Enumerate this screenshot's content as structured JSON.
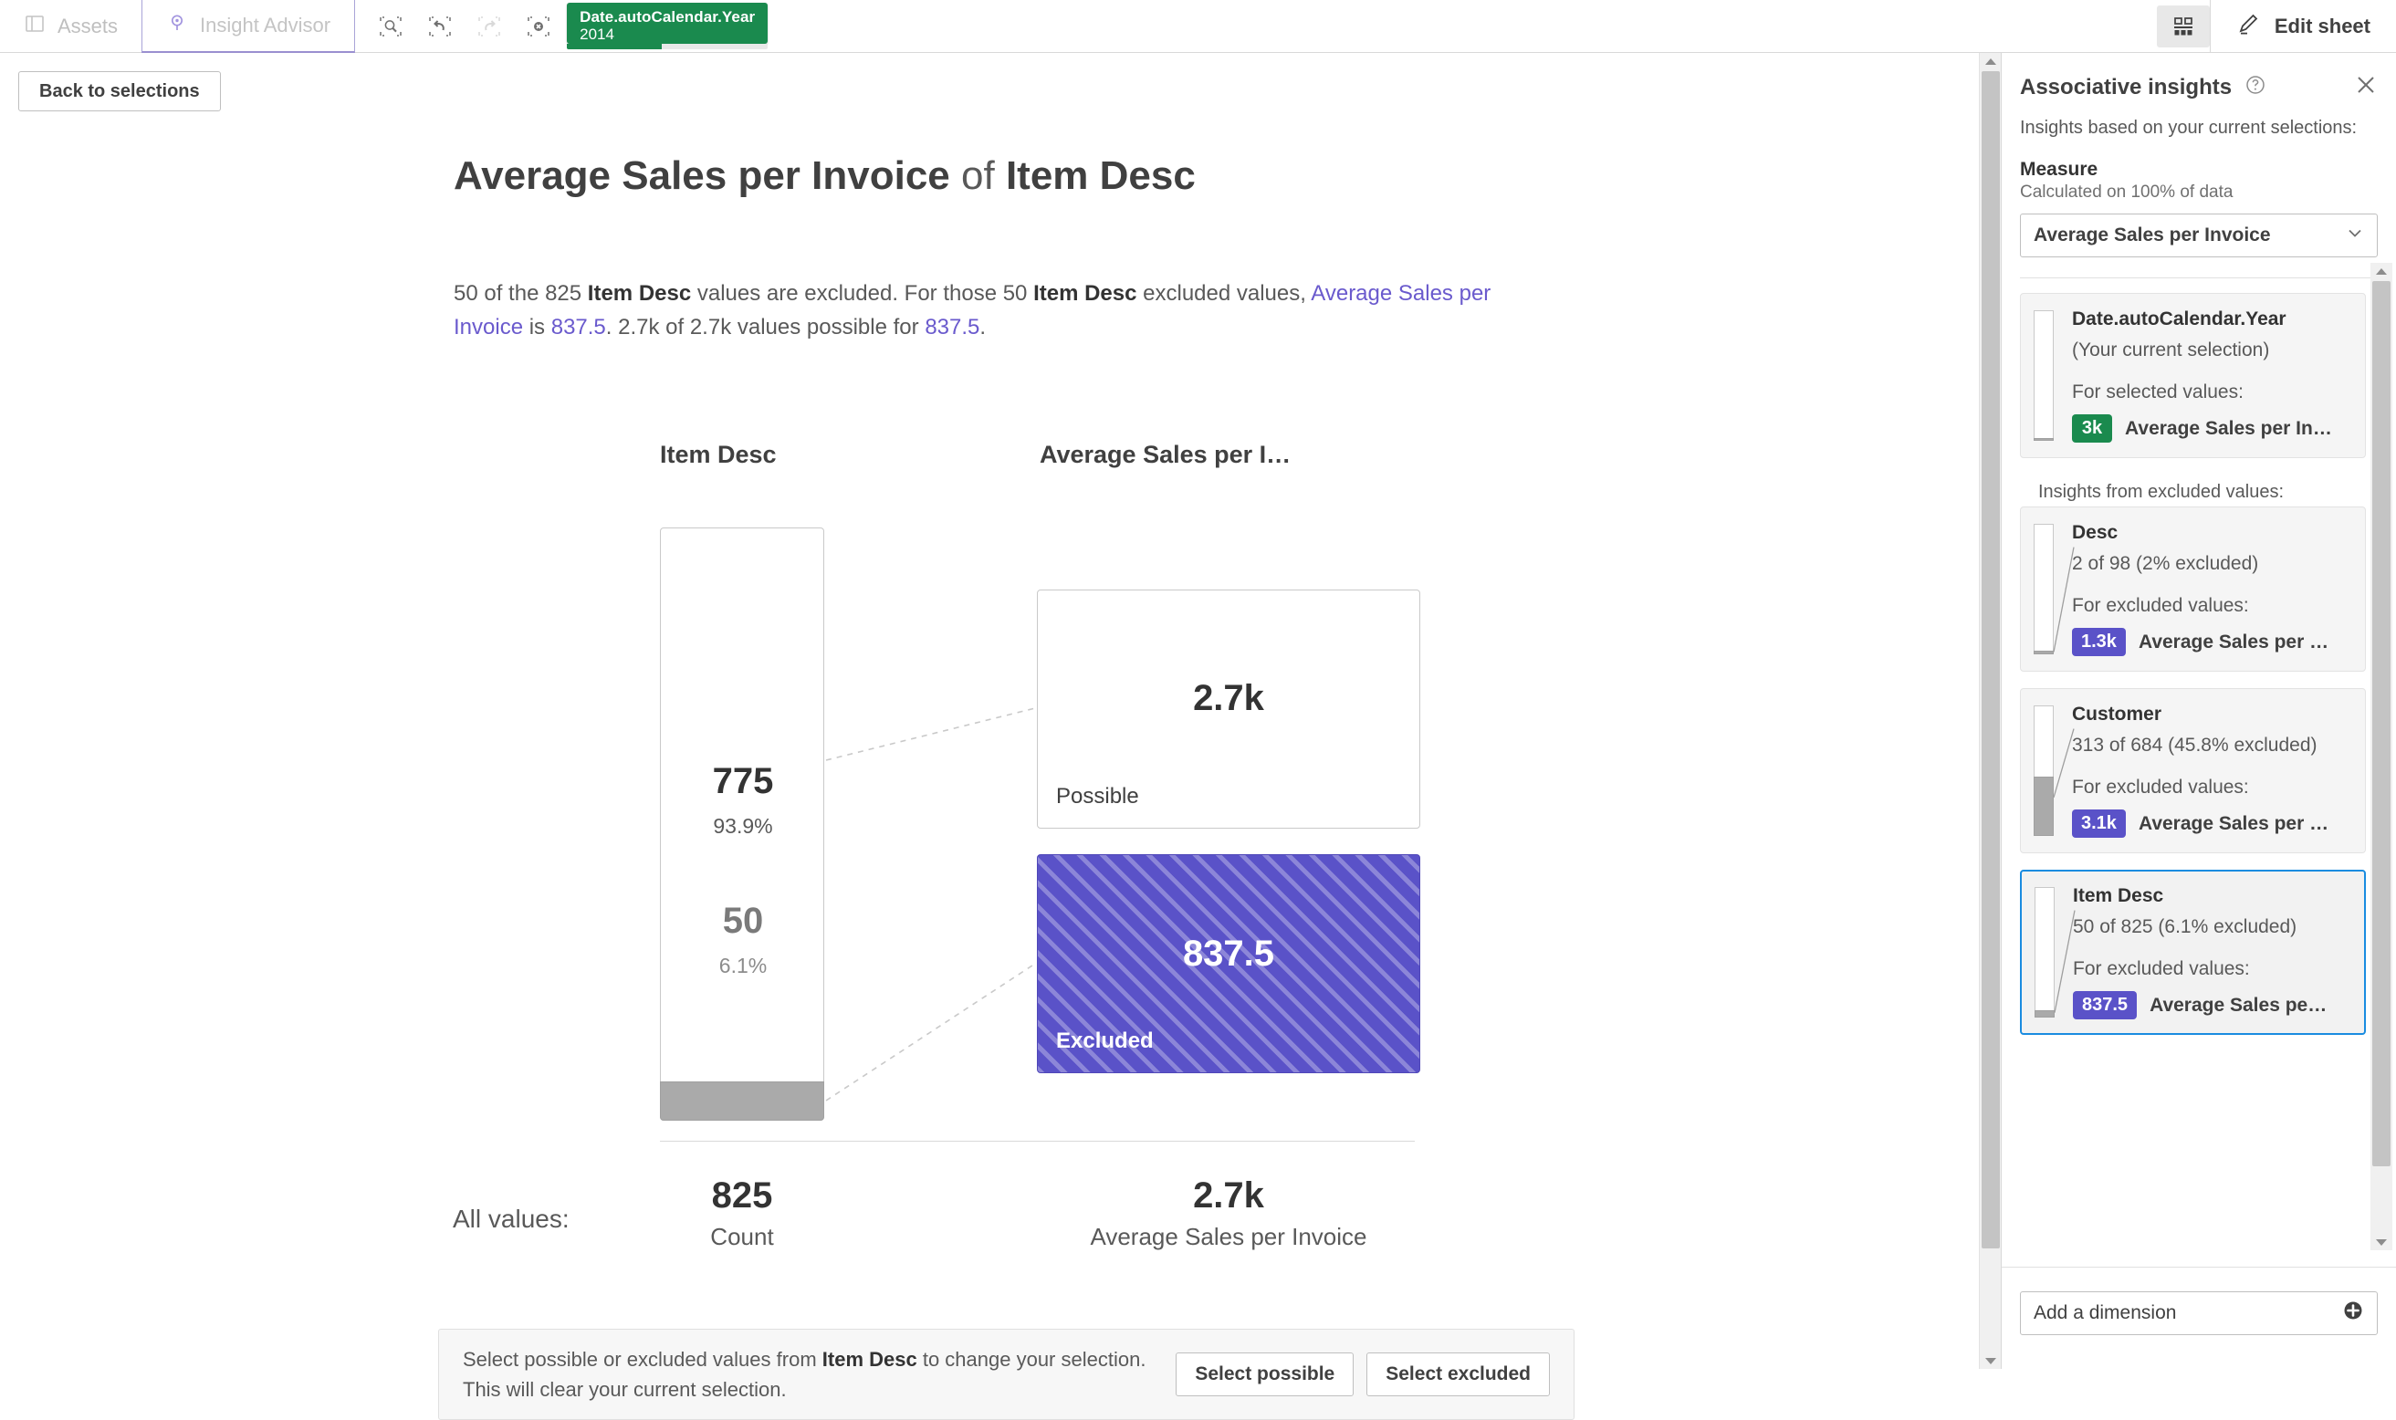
{
  "topbar": {
    "tabs": [
      {
        "label": "Assets",
        "icon": "panel-layout-icon",
        "active": false
      },
      {
        "label": "Insight Advisor",
        "icon": "insight-bulb-icon",
        "active": true
      }
    ],
    "tools": [
      {
        "name": "smart-search-icon",
        "disabled": false
      },
      {
        "name": "step-back-icon",
        "disabled": false
      },
      {
        "name": "step-forward-icon",
        "disabled": true
      },
      {
        "name": "clear-all-selections-icon",
        "disabled": false
      }
    ],
    "selection_chip": {
      "field": "Date.autoCalendar.Year",
      "value": "2014",
      "color": "#1a8a4e",
      "fill_percent": 47
    },
    "sheet_view_icon": "sheet-grid-icon",
    "edit_sheet_label": "Edit sheet",
    "edit_sheet_icon": "pencil-icon"
  },
  "main": {
    "back_button": "Back to selections",
    "title_prefix": "Average Sales per Invoice",
    "title_middle": " of ",
    "title_suffix": "Item Desc",
    "description": {
      "part1": "50 of the 825 ",
      "bold1": "Item Desc",
      "part2": " values are excluded. For those 50 ",
      "bold2": "Item Desc",
      "part3": " excluded values, ",
      "accent1": "Average Sales per Invoice",
      "part4": " is ",
      "accent2": "837.5",
      "part5": ". 2.7k of 2.7k values possible for ",
      "accent3": "837.5",
      "part6": "."
    },
    "columns": {
      "dimension_header": "Item Desc",
      "measure_header": "Average Sales per I…"
    },
    "dimension_bar": {
      "possible_value": "775",
      "possible_percent": "93.9%",
      "excluded_value": "50",
      "excluded_percent": "6.1%",
      "excluded_fraction": 0.061
    },
    "measure_boxes": [
      {
        "key": "Possible",
        "value": "2.7k",
        "state": "possible",
        "color": "#ffffff"
      },
      {
        "key": "Excluded",
        "value": "837.5",
        "state": "excluded",
        "color": "#5a52c8"
      }
    ],
    "all_values": {
      "label": "All values:",
      "dimension_value": "825",
      "dimension_key": "Count",
      "measure_value": "2.7k",
      "measure_key": "Average Sales per Invoice"
    },
    "footer": {
      "text_a": "Select possible or excluded values from ",
      "text_bold": "Item Desc",
      "text_b": " to change your selection. This will clear your current selection.",
      "select_possible": "Select possible",
      "select_excluded": "Select excluded"
    }
  },
  "panel": {
    "title": "Associative insights",
    "help_icon": "question-circle-icon",
    "close_icon": "close-icon",
    "subtitle": "Insights based on your current selections:",
    "measure_label": "Measure",
    "measure_note": "Calculated on 100% of data",
    "measure_selected": "Average Sales per Invoice",
    "measure_chevron_icon": "chevron-down-icon",
    "current_selection_card": {
      "name": "Date.autoCalendar.Year",
      "sub": "(Your current selection)",
      "for_label": "For selected values:",
      "badge": "3k",
      "badge_color": "#1a8a4e",
      "measure_name": "Average Sales per In…",
      "mini_excluded_fraction": 0.0
    },
    "excluded_heading": "Insights from excluded values:",
    "excluded_cards": [
      {
        "name": "Desc",
        "sub": "2 of 98 (2% excluded)",
        "for_label": "For excluded values:",
        "badge": "1.3k",
        "badge_color": "#5a52c8",
        "measure_name": "Average Sales per …",
        "mini_excluded_fraction": 0.02,
        "selected": false
      },
      {
        "name": "Customer",
        "sub": "313 of 684 (45.8% excluded)",
        "for_label": "For excluded values:",
        "badge": "3.1k",
        "badge_color": "#5a52c8",
        "measure_name": "Average Sales per …",
        "mini_excluded_fraction": 0.458,
        "selected": false
      },
      {
        "name": "Item Desc",
        "sub": "50 of 825 (6.1% excluded)",
        "for_label": "For excluded values:",
        "badge": "837.5",
        "badge_color": "#5a52c8",
        "measure_name": "Average Sales pe…",
        "mini_excluded_fraction": 0.061,
        "selected": true
      }
    ],
    "add_dimension_label": "Add a dimension",
    "add_dimension_icon": "plus-circle-icon"
  },
  "colors": {
    "accent_purple": "#5a52c8",
    "link_purple": "#6a5acd",
    "selection_green": "#1a8a4e",
    "selected_border_blue": "#1a8ce0",
    "excluded_grey": "#aaaaaa"
  },
  "chart_data": {
    "type": "bar",
    "title": "Average Sales per Invoice of Item Desc",
    "dimension": "Item Desc",
    "measure": "Average Sales per Invoice",
    "categories": [
      "Possible",
      "Excluded"
    ],
    "counts": [
      775,
      50
    ],
    "count_percents": [
      93.9,
      6.1
    ],
    "measure_values": [
      2700,
      837.5
    ],
    "measure_labels": [
      "2.7k",
      "837.5"
    ],
    "totals": {
      "count": 825,
      "count_label": "825",
      "measure": 2700,
      "measure_label": "2.7k"
    },
    "xlabel": "",
    "ylabel": "",
    "grid": false,
    "legend": "none"
  }
}
